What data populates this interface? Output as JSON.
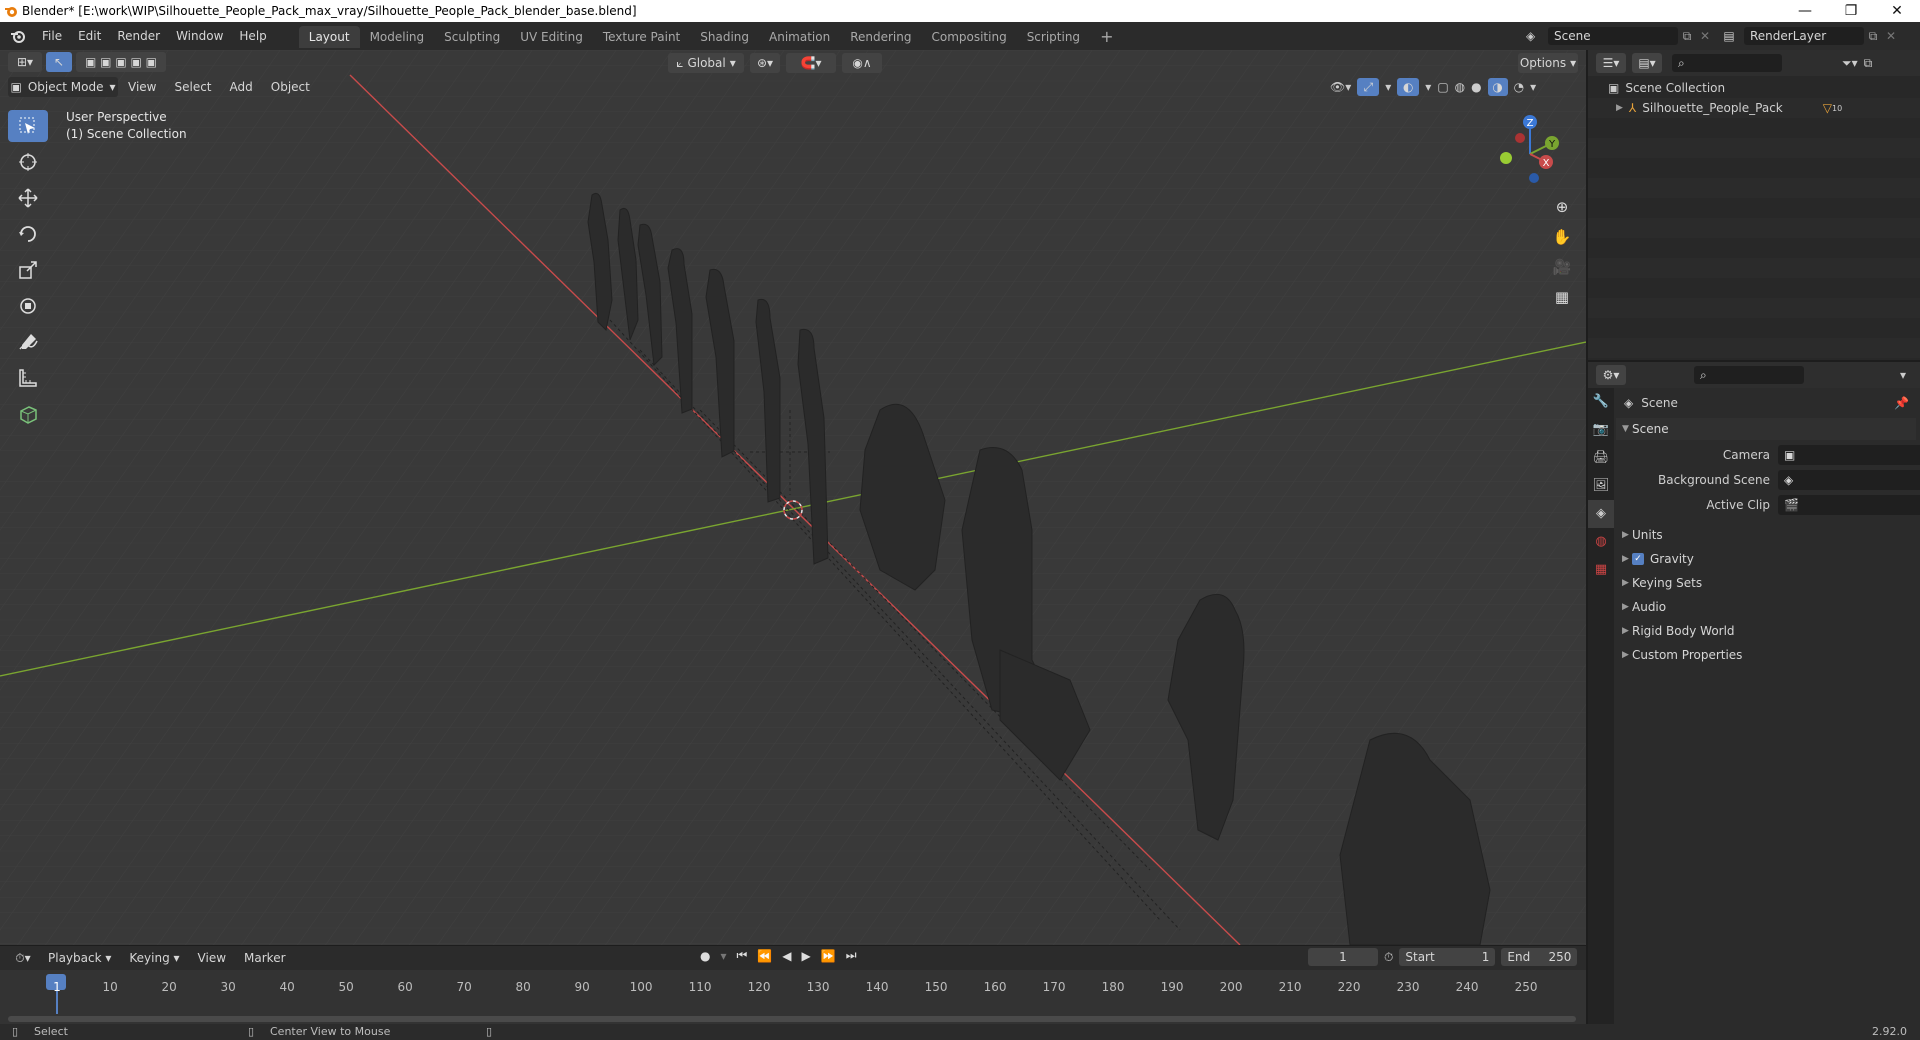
{
  "window": {
    "title": "Blender* [E:\\work\\WIP\\Silhouette_People_Pack_max_vray/Silhouette_People_Pack_blender_base.blend]",
    "minimize": "—",
    "maximize": "❐",
    "close": "✕"
  },
  "menu": [
    "File",
    "Edit",
    "Render",
    "Window",
    "Help"
  ],
  "workspaces": [
    "Layout",
    "Modeling",
    "Sculpting",
    "UV Editing",
    "Texture Paint",
    "Shading",
    "Animation",
    "Rendering",
    "Compositing",
    "Scripting"
  ],
  "active_workspace": "Layout",
  "scene_field": "Scene",
  "renderlayer_field": "RenderLayer",
  "viewport": {
    "mode": "Object Mode",
    "menus": [
      "View",
      "Select",
      "Add",
      "Object"
    ],
    "transform_orientation": "Global",
    "options_label": "Options",
    "overlay_line1": "User Perspective",
    "overlay_line2": "(1) Scene Collection"
  },
  "gizmo": {
    "x": "X",
    "y": "Y",
    "z": "Z"
  },
  "outliner": {
    "root": "Scene Collection",
    "items": [
      {
        "label": "Silhouette_People_Pack",
        "badge": "10"
      }
    ]
  },
  "properties": {
    "context": "Scene",
    "panel": "Scene",
    "fields": [
      {
        "label": "Camera",
        "value": ""
      },
      {
        "label": "Background Scene",
        "value": ""
      },
      {
        "label": "Active Clip",
        "value": ""
      }
    ],
    "subpanels": [
      "Units",
      "Gravity",
      "Keying Sets",
      "Audio",
      "Rigid Body World",
      "Custom Properties"
    ],
    "gravity_checked": true
  },
  "timeline": {
    "menus": [
      "Playback",
      "Keying",
      "View",
      "Marker"
    ],
    "current_frame": "1",
    "start_label": "Start",
    "start": "1",
    "end_label": "End",
    "end": "250",
    "ticks": [
      "1",
      "10",
      "20",
      "30",
      "40",
      "50",
      "60",
      "70",
      "80",
      "90",
      "100",
      "110",
      "120",
      "130",
      "140",
      "150",
      "160",
      "170",
      "180",
      "190",
      "200",
      "210",
      "220",
      "230",
      "240",
      "250"
    ]
  },
  "status": {
    "left": "Select",
    "middle": "Center View to Mouse",
    "version": "2.92.0"
  },
  "colors": {
    "accent": "#5680c2",
    "x_axis": "#c84b4b",
    "y_axis": "#7aa530",
    "z_axis": "#3b78d6"
  }
}
